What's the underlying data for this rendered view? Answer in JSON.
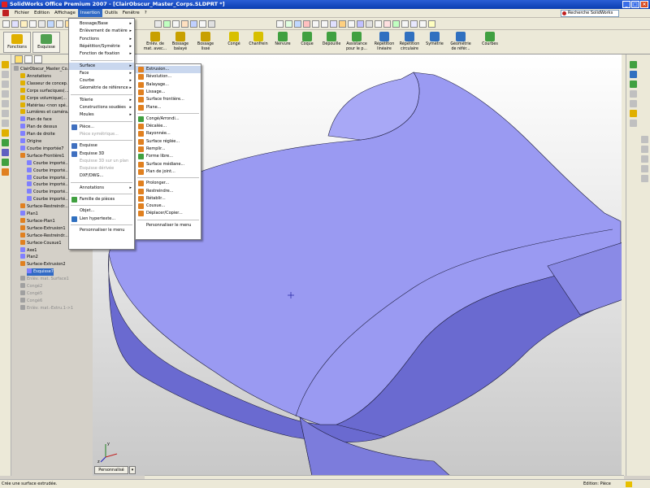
{
  "window": {
    "title": "SolidWorks Office Premium 2007 - [ClairObscur_Master_Corps.SLDPRT *]",
    "buttons": [
      "_",
      "□",
      "×"
    ]
  },
  "menubar": {
    "items": [
      "Fichier",
      "Edition",
      "Affichage",
      "Insertion",
      "Outils",
      "Fenêtre",
      "?"
    ],
    "active": "Insertion",
    "search_label": "Recherche SolidWorks"
  },
  "cmdmgr": {
    "tabs": [
      {
        "label": "Fonctions"
      },
      {
        "label": "Esquisse"
      }
    ],
    "buttons": [
      {
        "label": "Enlèv. de mat. avec...",
        "color": "#c8a000"
      },
      {
        "label": "Bossage balayé",
        "color": "#c8a000"
      },
      {
        "label": "Bossage lissé",
        "color": "#c8a000"
      },
      {
        "label": "Congé",
        "color": "#d8c000"
      },
      {
        "label": "Chanfrein",
        "color": "#d8c000"
      },
      {
        "label": "Nervure",
        "color": "#40a040"
      },
      {
        "label": "Coque",
        "color": "#40a040"
      },
      {
        "label": "Dépouille",
        "color": "#40a040"
      },
      {
        "label": "Assistance pour le p...",
        "color": "#40a040"
      },
      {
        "label": "Répétition linéaire",
        "color": "#3070c0"
      },
      {
        "label": "Répétition circulaire",
        "color": "#3070c0"
      },
      {
        "label": "Symétrie",
        "color": "#3070c0"
      },
      {
        "label": "Géométrie de référ...",
        "color": "#3070c0"
      },
      {
        "label": "Courbes",
        "color": "#40a040"
      }
    ]
  },
  "tree": {
    "items": [
      {
        "label": "ClairObscur_Master_Co...",
        "indent": 0,
        "color": "#a0a0a0"
      },
      {
        "label": "Annotations",
        "indent": 1,
        "color": "#e0b000"
      },
      {
        "label": "Classeur de concep...",
        "indent": 1,
        "color": "#e0b000"
      },
      {
        "label": "Corps surfaciques(...",
        "indent": 1,
        "color": "#e0b000"
      },
      {
        "label": "Corps volumique(...",
        "indent": 1,
        "color": "#e0b000"
      },
      {
        "label": "Matériau <non spé...",
        "indent": 1,
        "color": "#e0b000"
      },
      {
        "label": "Lumières et caméra...",
        "indent": 1,
        "color": "#e0b000"
      },
      {
        "label": "Plan de face",
        "indent": 1,
        "color": "#8080ff"
      },
      {
        "label": "Plan de dessus",
        "indent": 1,
        "color": "#8080ff"
      },
      {
        "label": "Plan de droite",
        "indent": 1,
        "color": "#8080ff"
      },
      {
        "label": "Origine",
        "indent": 1,
        "color": "#8080ff"
      },
      {
        "label": "Courbe importée7",
        "indent": 1,
        "color": "#8080ff"
      },
      {
        "label": "Surface-Frontière1",
        "indent": 1,
        "color": "#e08020"
      },
      {
        "label": "Courbe importé...",
        "indent": 2,
        "color": "#8080ff"
      },
      {
        "label": "Courbe importé...",
        "indent": 2,
        "color": "#8080ff"
      },
      {
        "label": "Courbe importé...",
        "indent": 2,
        "color": "#8080ff"
      },
      {
        "label": "Courbe importé...",
        "indent": 2,
        "color": "#8080ff"
      },
      {
        "label": "Courbe importé...",
        "indent": 2,
        "color": "#8080ff"
      },
      {
        "label": "Courbe importé...",
        "indent": 2,
        "color": "#8080ff"
      },
      {
        "label": "Surface-Restreindr...",
        "indent": 1,
        "color": "#e08020"
      },
      {
        "label": "Plan1",
        "indent": 1,
        "color": "#8080ff"
      },
      {
        "label": "Surface-Plan1",
        "indent": 1,
        "color": "#e08020"
      },
      {
        "label": "Surface-Extrusion1",
        "indent": 1,
        "color": "#e08020"
      },
      {
        "label": "Surface-Restreindr...",
        "indent": 1,
        "color": "#e08020"
      },
      {
        "label": "Surface-Cousue1",
        "indent": 1,
        "color": "#e08020"
      },
      {
        "label": "Axe1",
        "indent": 1,
        "color": "#8080ff"
      },
      {
        "label": "Plan2",
        "indent": 1,
        "color": "#8080ff"
      },
      {
        "label": "Surface-Extrusion2",
        "indent": 1,
        "color": "#e08020"
      },
      {
        "label": "Esquisse7",
        "indent": 2,
        "color": "#8080ff",
        "sel": true
      },
      {
        "label": "Enlèv. mat. Surface1",
        "indent": 1,
        "color": "#a0a0a0",
        "grey": true
      },
      {
        "label": "Congé2",
        "indent": 1,
        "color": "#a0a0a0",
        "grey": true
      },
      {
        "label": "Congé5",
        "indent": 1,
        "color": "#a0a0a0",
        "grey": true
      },
      {
        "label": "Congé6",
        "indent": 1,
        "color": "#a0a0a0",
        "grey": true
      },
      {
        "label": "Enlèv. mat.-Extru.1->1",
        "indent": 1,
        "color": "#a0a0a0",
        "grey": true
      }
    ]
  },
  "insertion_menu": {
    "items": [
      {
        "label": "Bossage/Base",
        "arrow": true
      },
      {
        "label": "Enlèvement de matière",
        "arrow": true
      },
      {
        "label": "Fonctions",
        "arrow": true
      },
      {
        "label": "Répétition/Symétrie",
        "arrow": true
      },
      {
        "label": "Fonction de fixation",
        "arrow": true
      },
      {
        "sep": true
      },
      {
        "label": "Surface",
        "arrow": true,
        "hl": true
      },
      {
        "label": "Face",
        "arrow": true
      },
      {
        "label": "Courbe",
        "arrow": true
      },
      {
        "label": "Géométrie de référence",
        "arrow": true
      },
      {
        "sep": true
      },
      {
        "label": "Tôlerie",
        "arrow": true
      },
      {
        "label": "Constructions soudées",
        "arrow": true
      },
      {
        "label": "Moules",
        "arrow": true
      },
      {
        "sep": true
      },
      {
        "label": "Pièce...",
        "icon": "#4070c0"
      },
      {
        "label": "Pièce symétrique...",
        "dis": true
      },
      {
        "sep": true
      },
      {
        "label": "Esquisse",
        "icon": "#4070c0"
      },
      {
        "label": "Esquisse 3D",
        "icon": "#4070c0"
      },
      {
        "label": "Esquisse 3D sur un plan",
        "dis": true
      },
      {
        "label": "Esquisse dérivée",
        "dis": true
      },
      {
        "label": "DXF/DWG..."
      },
      {
        "sep": true
      },
      {
        "label": "Annotations",
        "arrow": true
      },
      {
        "sep": true
      },
      {
        "label": "Famille de pièces",
        "icon": "#40a040"
      },
      {
        "sep": true
      },
      {
        "label": "Objet..."
      },
      {
        "label": "Lien hypertexte...",
        "icon": "#3070c0"
      },
      {
        "sep": true
      },
      {
        "label": "Personnaliser le menu"
      }
    ]
  },
  "surface_submenu": {
    "items": [
      {
        "label": "Extrusion...",
        "icon": "#e08020",
        "hl": true
      },
      {
        "label": "Révolution...",
        "icon": "#e08020"
      },
      {
        "label": "Balayage...",
        "icon": "#e08020"
      },
      {
        "label": "Lissage...",
        "icon": "#e08020"
      },
      {
        "label": "Surface frontière...",
        "icon": "#e08020"
      },
      {
        "label": "Plane...",
        "icon": "#e08020"
      },
      {
        "sep": true
      },
      {
        "label": "Congé/Arrondi...",
        "icon": "#40a040"
      },
      {
        "label": "Décalée...",
        "icon": "#e08020"
      },
      {
        "label": "Rayonnée...",
        "icon": "#e08020"
      },
      {
        "label": "Surface réglée...",
        "icon": "#e08020"
      },
      {
        "label": "Remplir...",
        "icon": "#e08020"
      },
      {
        "label": "Forme libre...",
        "icon": "#40a040"
      },
      {
        "label": "Surface médiane...",
        "icon": "#e08020"
      },
      {
        "label": "Plan de joint...",
        "icon": "#e08020"
      },
      {
        "sep": true
      },
      {
        "label": "Prolonger...",
        "icon": "#e08020"
      },
      {
        "label": "Restreindre...",
        "icon": "#e08020"
      },
      {
        "label": "Rétablir...",
        "icon": "#e08020"
      },
      {
        "label": "Cousue...",
        "icon": "#e08020"
      },
      {
        "label": "Déplacer/Copier...",
        "icon": "#e08020"
      },
      {
        "sep": true
      },
      {
        "label": "Personnaliser le menu"
      }
    ]
  },
  "viewport": {
    "model_color": "#9a9af2",
    "model_side_color": "#6a6ad0",
    "axis_labels": [
      "y",
      "z"
    ]
  },
  "view_tab": {
    "label": "Personnalisé",
    "arrow": "▾"
  },
  "status": {
    "left": "Crée une surface extrudée.",
    "right": "Edition: Pièce"
  }
}
